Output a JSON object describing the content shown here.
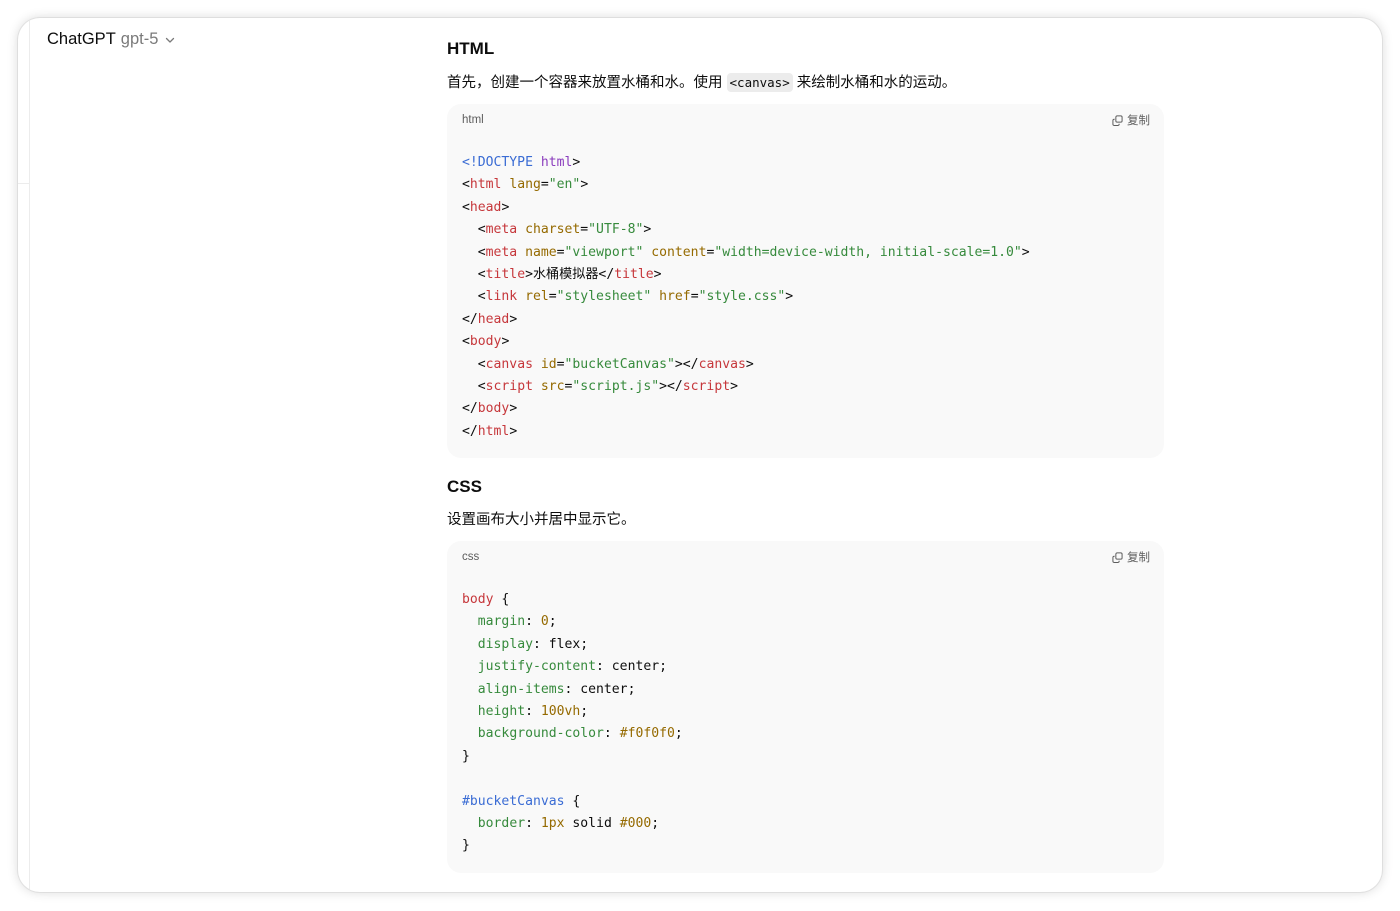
{
  "theme": {
    "text_primary": "#0d0d0d",
    "text_secondary": "#7a7a7a",
    "code_block_bg": "#f9f9f9",
    "inline_code_bg": "#ececec",
    "code_label": "#5d5d5d",
    "divider": "#ececec"
  },
  "icons": {
    "model_menu": "chevron-down-icon",
    "copy": "copy-icon"
  },
  "header": {
    "app_name": "ChatGPT",
    "model": "gpt-5"
  },
  "sections": [
    {
      "heading": "HTML",
      "intro": {
        "before": "首先，创建一个容器来放置水桶和水。使用 ",
        "code": "<canvas>",
        "after": " 来绘制水桶和水的运动。"
      },
      "code": {
        "language": "html",
        "copy_label": "复制",
        "lines": [
          [
            {
              "t": "<!DOCTYPE",
              "c": "#3a6cd4"
            },
            {
              "t": " "
            },
            {
              "t": "html",
              "c": "#8b3dbd"
            },
            {
              "t": ">"
            }
          ],
          [
            {
              "t": "<"
            },
            {
              "t": "html",
              "c": "#c6373b"
            },
            {
              "t": " "
            },
            {
              "t": "lang",
              "c": "#956a00"
            },
            {
              "t": "="
            },
            {
              "t": "\"en\"",
              "c": "#368a3c"
            },
            {
              "t": ">"
            }
          ],
          [
            {
              "t": "<"
            },
            {
              "t": "head",
              "c": "#c6373b"
            },
            {
              "t": ">"
            }
          ],
          [
            {
              "t": "  <"
            },
            {
              "t": "meta",
              "c": "#c6373b"
            },
            {
              "t": " "
            },
            {
              "t": "charset",
              "c": "#956a00"
            },
            {
              "t": "="
            },
            {
              "t": "\"UTF-8\"",
              "c": "#368a3c"
            },
            {
              "t": ">"
            }
          ],
          [
            {
              "t": "  <"
            },
            {
              "t": "meta",
              "c": "#c6373b"
            },
            {
              "t": " "
            },
            {
              "t": "name",
              "c": "#956a00"
            },
            {
              "t": "="
            },
            {
              "t": "\"viewport\"",
              "c": "#368a3c"
            },
            {
              "t": " "
            },
            {
              "t": "content",
              "c": "#956a00"
            },
            {
              "t": "="
            },
            {
              "t": "\"width=device-width, initial-scale=1.0\"",
              "c": "#368a3c"
            },
            {
              "t": ">"
            }
          ],
          [
            {
              "t": "  <"
            },
            {
              "t": "title",
              "c": "#c6373b"
            },
            {
              "t": ">水桶模拟器</"
            },
            {
              "t": "title",
              "c": "#c6373b"
            },
            {
              "t": ">"
            }
          ],
          [
            {
              "t": "  <"
            },
            {
              "t": "link",
              "c": "#c6373b"
            },
            {
              "t": " "
            },
            {
              "t": "rel",
              "c": "#956a00"
            },
            {
              "t": "="
            },
            {
              "t": "\"stylesheet\"",
              "c": "#368a3c"
            },
            {
              "t": " "
            },
            {
              "t": "href",
              "c": "#956a00"
            },
            {
              "t": "="
            },
            {
              "t": "\"style.css\"",
              "c": "#368a3c"
            },
            {
              "t": ">"
            }
          ],
          [
            {
              "t": "</"
            },
            {
              "t": "head",
              "c": "#c6373b"
            },
            {
              "t": ">"
            }
          ],
          [
            {
              "t": "<"
            },
            {
              "t": "body",
              "c": "#c6373b"
            },
            {
              "t": ">"
            }
          ],
          [
            {
              "t": "  <"
            },
            {
              "t": "canvas",
              "c": "#c6373b"
            },
            {
              "t": " "
            },
            {
              "t": "id",
              "c": "#956a00"
            },
            {
              "t": "="
            },
            {
              "t": "\"bucketCanvas\"",
              "c": "#368a3c"
            },
            {
              "t": "></"
            },
            {
              "t": "canvas",
              "c": "#c6373b"
            },
            {
              "t": ">"
            }
          ],
          [
            {
              "t": "  <"
            },
            {
              "t": "script",
              "c": "#c6373b"
            },
            {
              "t": " "
            },
            {
              "t": "src",
              "c": "#956a00"
            },
            {
              "t": "="
            },
            {
              "t": "\"script.js\"",
              "c": "#368a3c"
            },
            {
              "t": "></"
            },
            {
              "t": "script",
              "c": "#c6373b"
            },
            {
              "t": ">"
            }
          ],
          [
            {
              "t": "</"
            },
            {
              "t": "body",
              "c": "#c6373b"
            },
            {
              "t": ">"
            }
          ],
          [
            {
              "t": "</"
            },
            {
              "t": "html",
              "c": "#c6373b"
            },
            {
              "t": ">"
            }
          ]
        ]
      }
    },
    {
      "heading": "CSS",
      "intro": {
        "text": "设置画布大小并居中显示它。"
      },
      "code": {
        "language": "css",
        "copy_label": "复制",
        "lines": [
          [
            {
              "t": "body",
              "c": "#c6373b"
            },
            {
              "t": " {"
            }
          ],
          [
            {
              "t": "  "
            },
            {
              "t": "margin",
              "c": "#368a3c"
            },
            {
              "t": ": "
            },
            {
              "t": "0",
              "c": "#956a00"
            },
            {
              "t": ";"
            }
          ],
          [
            {
              "t": "  "
            },
            {
              "t": "display",
              "c": "#368a3c"
            },
            {
              "t": ": flex;"
            }
          ],
          [
            {
              "t": "  "
            },
            {
              "t": "justify-content",
              "c": "#368a3c"
            },
            {
              "t": ": center;"
            }
          ],
          [
            {
              "t": "  "
            },
            {
              "t": "align-items",
              "c": "#368a3c"
            },
            {
              "t": ": center;"
            }
          ],
          [
            {
              "t": "  "
            },
            {
              "t": "height",
              "c": "#368a3c"
            },
            {
              "t": ": "
            },
            {
              "t": "100vh",
              "c": "#956a00"
            },
            {
              "t": ";"
            }
          ],
          [
            {
              "t": "  "
            },
            {
              "t": "background-color",
              "c": "#368a3c"
            },
            {
              "t": ": "
            },
            {
              "t": "#f0f0f0",
              "c": "#956a00"
            },
            {
              "t": ";"
            }
          ],
          [
            {
              "t": "}"
            }
          ],
          [],
          [
            {
              "t": "#bucketCanvas",
              "c": "#3a6cd4"
            },
            {
              "t": " {"
            }
          ],
          [
            {
              "t": "  "
            },
            {
              "t": "border",
              "c": "#368a3c"
            },
            {
              "t": ": "
            },
            {
              "t": "1px",
              "c": "#956a00"
            },
            {
              "t": " solid "
            },
            {
              "t": "#000",
              "c": "#956a00"
            },
            {
              "t": ";"
            }
          ],
          [
            {
              "t": "}"
            }
          ]
        ]
      }
    }
  ]
}
